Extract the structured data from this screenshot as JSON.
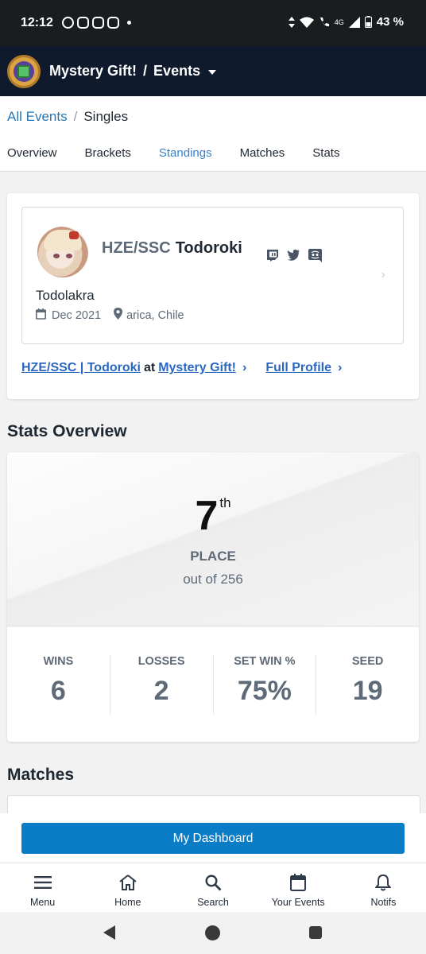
{
  "status_bar": {
    "time": "12:12",
    "signal": "4G",
    "battery": "43 %"
  },
  "header": {
    "app": "Mystery Gift!",
    "separator": "/",
    "section": "Events"
  },
  "breadcrumb": {
    "parent": "All Events",
    "separator": "/",
    "current": "Singles"
  },
  "tabs": [
    {
      "label": "Overview",
      "active": false
    },
    {
      "label": "Brackets",
      "active": false
    },
    {
      "label": "Standings",
      "active": true
    },
    {
      "label": "Matches",
      "active": false
    },
    {
      "label": "Stats",
      "active": false
    }
  ],
  "player": {
    "prefix": "HZE/SSC",
    "gamertag": "Todoroki",
    "real_name": "Todolakra",
    "joined": "Dec 2021",
    "location": "arica, Chile",
    "social_icons": [
      "twitch-icon",
      "twitter-icon",
      "discord-icon"
    ],
    "event_link": {
      "player": "HZE/SSC | Todoroki",
      "at": "at",
      "event": "Mystery Gift!"
    },
    "full_profile_label": "Full Profile"
  },
  "stats": {
    "heading": "Stats Overview",
    "placement": "7",
    "placement_suffix": "th",
    "placement_label": "PLACE",
    "out_of": "out of 256",
    "items": [
      {
        "label": "WINS",
        "value": "6"
      },
      {
        "label": "LOSSES",
        "value": "2"
      },
      {
        "label": "SET WIN %",
        "value": "75%"
      },
      {
        "label": "SEED",
        "value": "19"
      }
    ]
  },
  "matches": {
    "heading": "Matches"
  },
  "dashboard_button": "My Dashboard",
  "bottom_nav": [
    {
      "label": "Menu",
      "icon": "menu-icon"
    },
    {
      "label": "Home",
      "icon": "home-icon"
    },
    {
      "label": "Search",
      "icon": "search-icon"
    },
    {
      "label": "Your Events",
      "icon": "calendar-icon"
    },
    {
      "label": "Notifs",
      "icon": "bell-icon"
    }
  ],
  "colors": {
    "header_bg": "#0f1a2d",
    "link": "#2a67c2",
    "active_tab": "#3a82c8",
    "primary_button": "#0b7dc7"
  }
}
